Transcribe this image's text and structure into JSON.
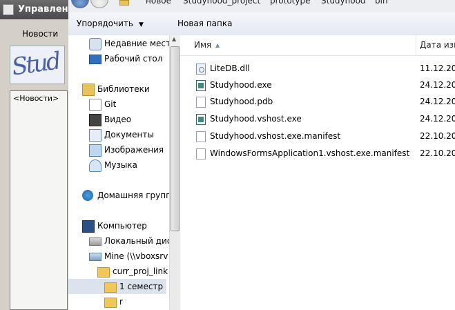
{
  "background_window": {
    "title": "Управлен",
    "tab_label": "Новости",
    "captcha_text": "Stud",
    "list_item": "<Новости>"
  },
  "explorer": {
    "breadcrumb": [
      "новое",
      "Studyhood_project",
      "prototype",
      "Studyhood",
      "bin"
    ],
    "toolbar": {
      "organize_label": "Упорядочить",
      "new_folder_label": "Новая папка"
    },
    "nav": {
      "recent": "Недавние мест",
      "desktop": "Рабочий стол",
      "libraries": "Библиотеки",
      "git": "Git",
      "video": "Видео",
      "documents": "Документы",
      "pictures": "Изображения",
      "music": "Музыка",
      "homegroup": "Домашняя групп",
      "computer": "Компьютер",
      "local_disk": "Локальный дис",
      "mine_share": "Mine (\\\\vboxsrv",
      "curr_proj": "curr_proj_link",
      "semester": "1 семестр",
      "r": "r"
    },
    "columns": {
      "name": "Имя",
      "date": "Дата изм"
    },
    "files": [
      {
        "name": "LiteDB.dll",
        "date": "11.12.20",
        "icon": "dll-icon"
      },
      {
        "name": "Studyhood.exe",
        "date": "24.12.20",
        "icon": "exe-icon"
      },
      {
        "name": "Studyhood.pdb",
        "date": "24.12.20",
        "icon": "file-icon"
      },
      {
        "name": "Studyhood.vshost.exe",
        "date": "24.12.20",
        "icon": "exe-icon"
      },
      {
        "name": "Studyhood.vshost.exe.manifest",
        "date": "22.10.20",
        "icon": "file-icon"
      },
      {
        "name": "WindowsFormsApplication1.vshost.exe.manifest",
        "date": "22.10.20",
        "icon": "file-icon"
      }
    ]
  },
  "colors": {
    "nav_selection": "#dde3ec",
    "toolbar_bg": "#e4e8f0",
    "titlebar_dark": "#4a4a4a"
  }
}
